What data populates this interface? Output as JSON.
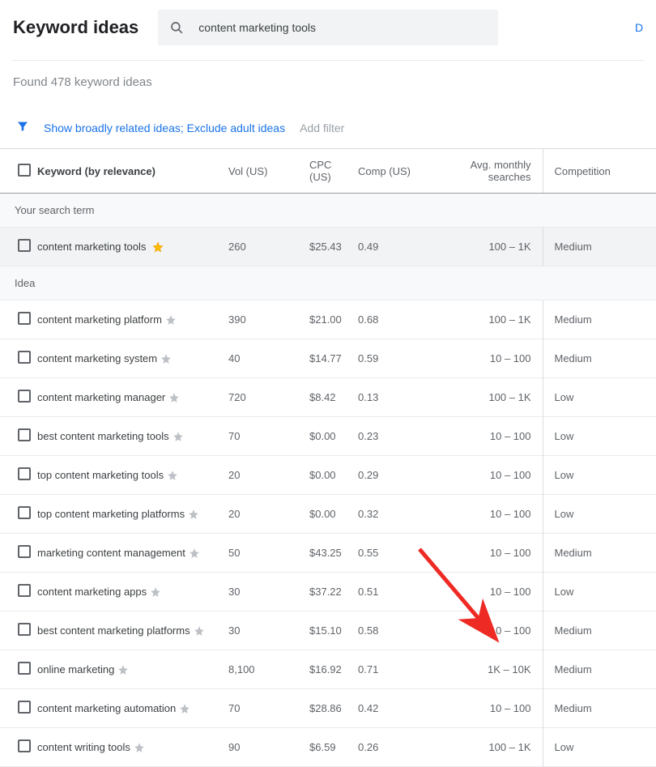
{
  "header": {
    "title": "Keyword ideas",
    "search_value": "content marketing tools",
    "right_link": "D"
  },
  "found_text": "Found 478 keyword ideas",
  "filters": {
    "active": "Show broadly related ideas; Exclude adult ideas",
    "add": "Add filter"
  },
  "columns": {
    "keyword": "Keyword (by relevance)",
    "vol": "Vol (US)",
    "cpc": "CPC (US)",
    "comp": "Comp (US)",
    "searches": "Avg. monthly searches",
    "competition": "Competition"
  },
  "sections": {
    "search_term": "Your search term",
    "idea": "Idea"
  },
  "search_term_row": {
    "keyword": "content marketing tools",
    "vol": "260",
    "cpc": "$25.43",
    "comp": "0.49",
    "searches": "100 – 1K",
    "competition": "Medium",
    "starred": true
  },
  "ideas": [
    {
      "keyword": "content marketing platform",
      "vol": "390",
      "cpc": "$21.00",
      "comp": "0.68",
      "searches": "100 – 1K",
      "competition": "Medium"
    },
    {
      "keyword": "content marketing system",
      "vol": "40",
      "cpc": "$14.77",
      "comp": "0.59",
      "searches": "10 – 100",
      "competition": "Medium"
    },
    {
      "keyword": "content marketing manager",
      "vol": "720",
      "cpc": "$8.42",
      "comp": "0.13",
      "searches": "100 – 1K",
      "competition": "Low"
    },
    {
      "keyword": "best content marketing tools",
      "vol": "70",
      "cpc": "$0.00",
      "comp": "0.23",
      "searches": "10 – 100",
      "competition": "Low"
    },
    {
      "keyword": "top content marketing tools",
      "vol": "20",
      "cpc": "$0.00",
      "comp": "0.29",
      "searches": "10 – 100",
      "competition": "Low"
    },
    {
      "keyword": "top content marketing platforms",
      "vol": "20",
      "cpc": "$0.00",
      "comp": "0.32",
      "searches": "10 – 100",
      "competition": "Low"
    },
    {
      "keyword": "marketing content management",
      "vol": "50",
      "cpc": "$43.25",
      "comp": "0.55",
      "searches": "10 – 100",
      "competition": "Medium"
    },
    {
      "keyword": "content marketing apps",
      "vol": "30",
      "cpc": "$37.22",
      "comp": "0.51",
      "searches": "10 – 100",
      "competition": "Low"
    },
    {
      "keyword": "best content marketing platforms",
      "vol": "30",
      "cpc": "$15.10",
      "comp": "0.58",
      "searches": "10 – 100",
      "competition": "Medium"
    },
    {
      "keyword": "online marketing",
      "vol": "8,100",
      "cpc": "$16.92",
      "comp": "0.71",
      "searches": "1K – 10K",
      "competition": "Medium"
    },
    {
      "keyword": "content marketing automation",
      "vol": "70",
      "cpc": "$28.86",
      "comp": "0.42",
      "searches": "10 – 100",
      "competition": "Medium"
    },
    {
      "keyword": "content writing tools",
      "vol": "90",
      "cpc": "$6.59",
      "comp": "0.26",
      "searches": "100 – 1K",
      "competition": "Low"
    }
  ]
}
